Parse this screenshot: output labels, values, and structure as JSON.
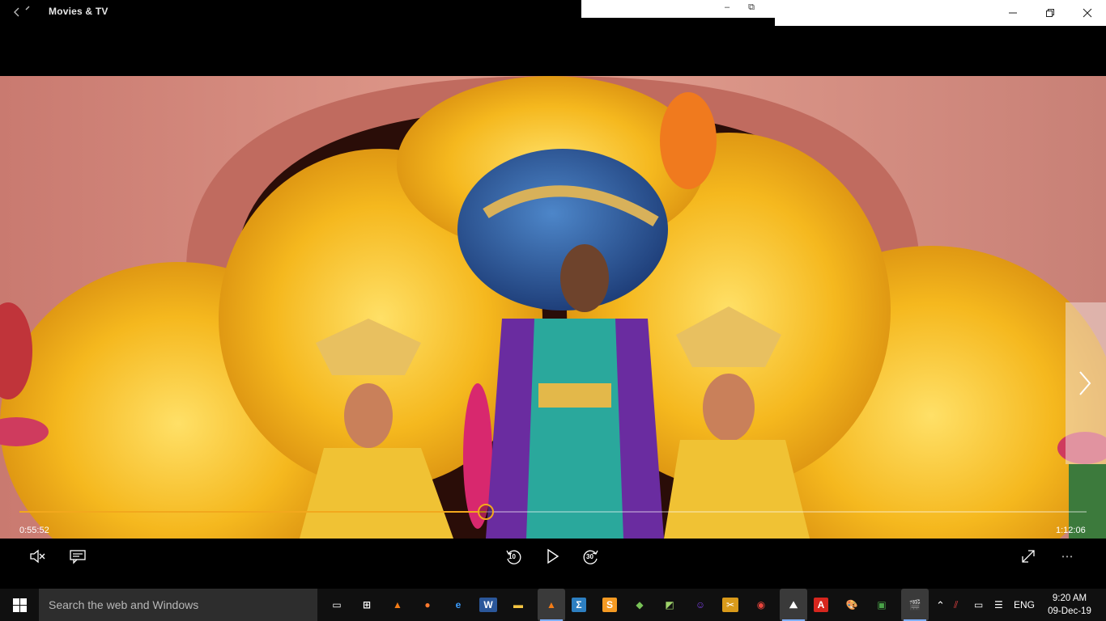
{
  "titlebar": {
    "app_title": "Movies & TV",
    "back_icon": "back-arrow-icon",
    "mini_minimize": "–",
    "mini_restore": "⧉"
  },
  "player": {
    "elapsed": "0:55:52",
    "total": "1:12:06",
    "progress_fraction": 0.4367,
    "accent_color": "#f2a81d",
    "next_icon": "chevron-right-icon"
  },
  "controls": {
    "mute_icon": "volume-mute-icon",
    "captions_icon": "captions-icon",
    "skip_back_label": "10",
    "play_icon": "play-icon",
    "skip_forward_label": "30",
    "fullscreen_icon": "fullscreen-icon",
    "more_label": "• • •"
  },
  "taskbar": {
    "search_placeholder": "Search the web and Windows",
    "language": "ENG",
    "time": "9:20 AM",
    "date": "09-Dec-19",
    "apps": [
      {
        "name": "task-view-icon",
        "glyph": "▭",
        "color": "#ffffff",
        "bg": "transparent"
      },
      {
        "name": "network-tool-icon",
        "glyph": "⊞",
        "color": "#ffffff",
        "bg": "transparent"
      },
      {
        "name": "vlc-icon",
        "glyph": "▲",
        "color": "#f47c16",
        "bg": "transparent"
      },
      {
        "name": "firefox-icon",
        "glyph": "●",
        "color": "#ff7a2e",
        "bg": "transparent"
      },
      {
        "name": "edge-icon",
        "glyph": "e",
        "color": "#3b9dff",
        "bg": "transparent"
      },
      {
        "name": "word-icon",
        "glyph": "W",
        "color": "#ffffff",
        "bg": "#2b579a"
      },
      {
        "name": "file-explorer-icon",
        "glyph": "▬",
        "color": "#f5c542",
        "bg": "transparent"
      },
      {
        "name": "vlc-active-icon",
        "glyph": "▲",
        "color": "#f47c16",
        "bg": "active"
      },
      {
        "name": "calculator-app-icon",
        "glyph": "Σ",
        "color": "#ffffff",
        "bg": "#2d7fc1"
      },
      {
        "name": "sublime-icon",
        "glyph": "S",
        "color": "#ffffff",
        "bg": "#f59a23"
      },
      {
        "name": "android-studio-icon",
        "glyph": "◆",
        "color": "#78c257",
        "bg": "transparent"
      },
      {
        "name": "notes-icon",
        "glyph": "◩",
        "color": "#9ed36a",
        "bg": "transparent"
      },
      {
        "name": "yahoo-messenger-icon",
        "glyph": "☺",
        "color": "#7b3fe4",
        "bg": "transparent"
      },
      {
        "name": "snipping-tool-icon",
        "glyph": "✂",
        "color": "#ffffff",
        "bg": "#d99a1a"
      },
      {
        "name": "chrome-icon",
        "glyph": "◉",
        "color": "#e8453c",
        "bg": "transparent"
      },
      {
        "name": "mountain-app-icon",
        "glyph": "⛰",
        "color": "#ffffff",
        "bg": "active"
      },
      {
        "name": "acrobat-icon",
        "glyph": "A",
        "color": "#ffffff",
        "bg": "#d7261e"
      },
      {
        "name": "paint-icon",
        "glyph": "🎨",
        "color": "#ffffff",
        "bg": "transparent"
      },
      {
        "name": "photos-icon",
        "glyph": "▣",
        "color": "#49a248",
        "bg": "transparent"
      },
      {
        "name": "movies-tv-icon",
        "glyph": "🎬",
        "color": "#ffffff",
        "bg": "active"
      }
    ]
  }
}
